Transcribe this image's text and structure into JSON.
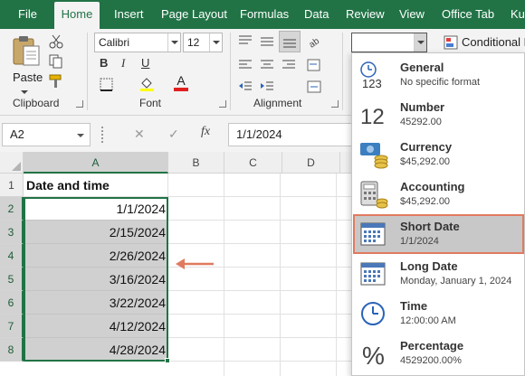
{
  "tabs": [
    "File",
    "Home",
    "Insert",
    "Page Layout",
    "Formulas",
    "Data",
    "Review",
    "View",
    "Office Tab",
    "Kutools"
  ],
  "active_tab": "Home",
  "ribbon": {
    "paste_label": "Paste",
    "clipboard_label": "Clipboard",
    "font_name": "Calibri",
    "font_size": "12",
    "font_label": "Font",
    "alignment_label": "Alignment",
    "number_format_value": "",
    "conditional_formatting_label": "Conditional F"
  },
  "formula_bar": {
    "name_box": "A2",
    "fx_label": "fx",
    "content": "1/1/2024"
  },
  "columns": [
    "A",
    "B",
    "C",
    "D"
  ],
  "rows": [
    "1",
    "2",
    "3",
    "4",
    "5",
    "6",
    "7",
    "8"
  ],
  "sheet": {
    "header": "Date and time",
    "dates": [
      "1/1/2024",
      "2/15/2024",
      "2/26/2024",
      "3/16/2024",
      "3/22/2024",
      "4/12/2024",
      "4/28/2024"
    ]
  },
  "number_formats": [
    {
      "name": "General",
      "example": "No specific format",
      "icon": "general-format-icon"
    },
    {
      "name": "Number",
      "example": "45292.00",
      "icon": "number-format-icon"
    },
    {
      "name": "Currency",
      "example": "$45,292.00",
      "icon": "currency-format-icon"
    },
    {
      "name": "Accounting",
      "example": "$45,292.00",
      "icon": "accounting-format-icon"
    },
    {
      "name": "Short Date",
      "example": "1/1/2024",
      "icon": "calendar-icon"
    },
    {
      "name": "Long Date",
      "example": "Monday, January 1, 2024",
      "icon": "calendar-icon"
    },
    {
      "name": "Time",
      "example": "12:00:00 AM",
      "icon": "clock-icon"
    },
    {
      "name": "Percentage",
      "example": "4529200.00%",
      "icon": "percent-icon"
    }
  ],
  "highlighted_format": "Short Date",
  "colors": {
    "excel_green": "#217346",
    "highlight_border": "#e07a5f",
    "arrow": "#e07a5f",
    "font_color_bar": "#e02020",
    "fill_color_bar": "#ffff00"
  }
}
